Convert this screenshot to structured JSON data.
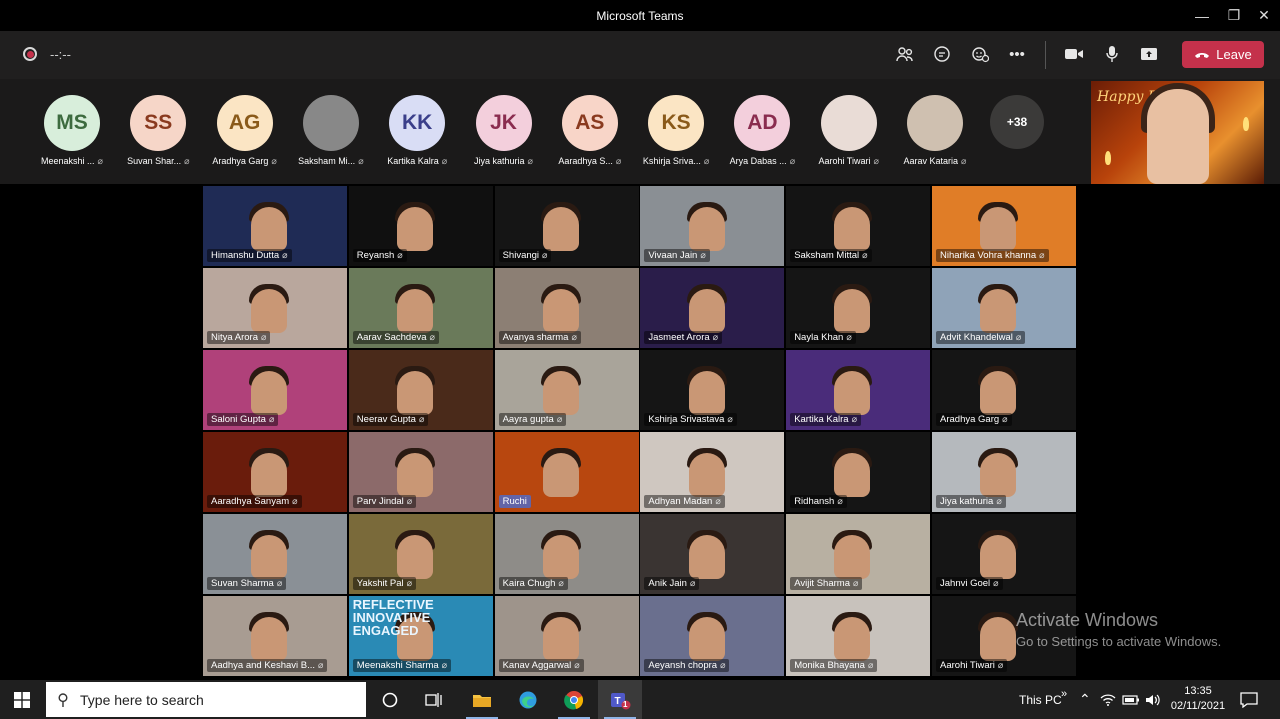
{
  "window": {
    "title": "Microsoft Teams"
  },
  "meeting": {
    "timer": "--:--",
    "leave_label": "Leave",
    "brand_color": "#c4314b",
    "accent_color": "#6264a7"
  },
  "strip": {
    "participants": [
      {
        "initials": "MS",
        "name": "Meenakshi ...",
        "bg": "#d8eedb",
        "fg": "#3d6b3f"
      },
      {
        "initials": "SS",
        "name": "Suvan Shar...",
        "bg": "#f6d6c8",
        "fg": "#8a3a1f"
      },
      {
        "initials": "AG",
        "name": "Aradhya Garg",
        "bg": "#fbe5c4",
        "fg": "#8a5a1a"
      },
      {
        "initials": "",
        "name": "Saksham Mi...",
        "bg": "#888",
        "fg": "#fff"
      },
      {
        "initials": "KK",
        "name": "Kartika Kalra",
        "bg": "#d9ddf5",
        "fg": "#3b3f8a"
      },
      {
        "initials": "JK",
        "name": "Jiya kathuria",
        "bg": "#f3cfdc",
        "fg": "#8a2c4f"
      },
      {
        "initials": "AS",
        "name": "Aaradhya S...",
        "bg": "#f8d5c8",
        "fg": "#8a3a1f"
      },
      {
        "initials": "KS",
        "name": "Kshirja Sriva...",
        "bg": "#fbe5c4",
        "fg": "#8a5a1a"
      },
      {
        "initials": "AD",
        "name": "Arya Dabas ...",
        "bg": "#f3cfdc",
        "fg": "#8a2c4f"
      },
      {
        "initials": "",
        "name": "Aarohi Tiwari",
        "bg": "#e9dcd6",
        "fg": "#fff"
      },
      {
        "initials": "",
        "name": "Aarav Kataria",
        "bg": "#cfc0b0",
        "fg": "#fff"
      }
    ],
    "overflow_count": "+38"
  },
  "presenter_banner": "Happy Diwali",
  "grid": {
    "tiles": [
      {
        "name": "Himanshu Dutta",
        "bg": "#1f2b55"
      },
      {
        "name": "Reyansh",
        "bg": "#101010"
      },
      {
        "name": "Shivangi",
        "bg": "#151515"
      },
      {
        "name": "Vivaan Jain",
        "bg": "#8a8f94"
      },
      {
        "name": "Saksham Mittal",
        "bg": "#141414"
      },
      {
        "name": "Niharika Vohra khanna",
        "bg": "#e07d27"
      },
      {
        "name": "Nitya Arora",
        "bg": "#b9a79d"
      },
      {
        "name": "Aarav Sachdeva",
        "bg": "#6a7a5a"
      },
      {
        "name": "Avanya sharma",
        "bg": "#8c7f74"
      },
      {
        "name": "Jasmeet Arora",
        "bg": "#2a1d4a"
      },
      {
        "name": "Nayla Khan",
        "bg": "#151515"
      },
      {
        "name": "Advit Khandelwal",
        "bg": "#8fa3b8"
      },
      {
        "name": "Saloni Gupta",
        "bg": "#b0417a"
      },
      {
        "name": "Neerav Gupta",
        "bg": "#4a2a1a"
      },
      {
        "name": "Aayra gupta",
        "bg": "#a9a49a"
      },
      {
        "name": "Kshirja Srivastava",
        "bg": "#151515"
      },
      {
        "name": "Kartika Kalra",
        "bg": "#4a2c7a"
      },
      {
        "name": "Aradhya Garg",
        "bg": "#151515"
      },
      {
        "name": "Aaradhya Sanyam",
        "bg": "#6a1c0c"
      },
      {
        "name": "Parv Jindal",
        "bg": "#8c6a6a"
      },
      {
        "name": "Ruchi",
        "bg": "#b8470f"
      },
      {
        "name": "Adhyan Madan",
        "bg": "#cfc7c0"
      },
      {
        "name": "Ridhansh",
        "bg": "#151515"
      },
      {
        "name": "Jiya kathuria",
        "bg": "#b5b9bd"
      },
      {
        "name": "Suvan Sharma",
        "bg": "#8a9096"
      },
      {
        "name": "Yakshit Pal",
        "bg": "#7a6a3a"
      },
      {
        "name": "Kaira Chugh",
        "bg": "#8e8c88"
      },
      {
        "name": "Anik Jain",
        "bg": "#3a3432"
      },
      {
        "name": "Avijit Sharma",
        "bg": "#b8b0a2"
      },
      {
        "name": "Jahnvi Goel",
        "bg": "#151515"
      },
      {
        "name": "Aadhya and Keshavi B...",
        "bg": "#a89c92"
      },
      {
        "name": "Meenakshi Sharma",
        "bg": "#2a8ab5"
      },
      {
        "name": "Kanav Aggarwal",
        "bg": "#9e948b"
      },
      {
        "name": "Aeyansh chopra",
        "bg": "#6a6f8e"
      },
      {
        "name": "Monika Bhayana",
        "bg": "#c8c2bc"
      },
      {
        "name": "Aarohi Tiwari",
        "bg": "#151515"
      }
    ],
    "highlighted": "Ruchi",
    "overlay_text": "REFLECTIVE INNOVATIVE ENGAGED"
  },
  "watermark": {
    "line1": "Activate Windows",
    "line2": "Go to Settings to activate Windows."
  },
  "taskbar": {
    "search_placeholder": "Type here to search",
    "location": "This PC",
    "time": "13:35",
    "date": "02/11/2021",
    "teams_badge": "1"
  }
}
